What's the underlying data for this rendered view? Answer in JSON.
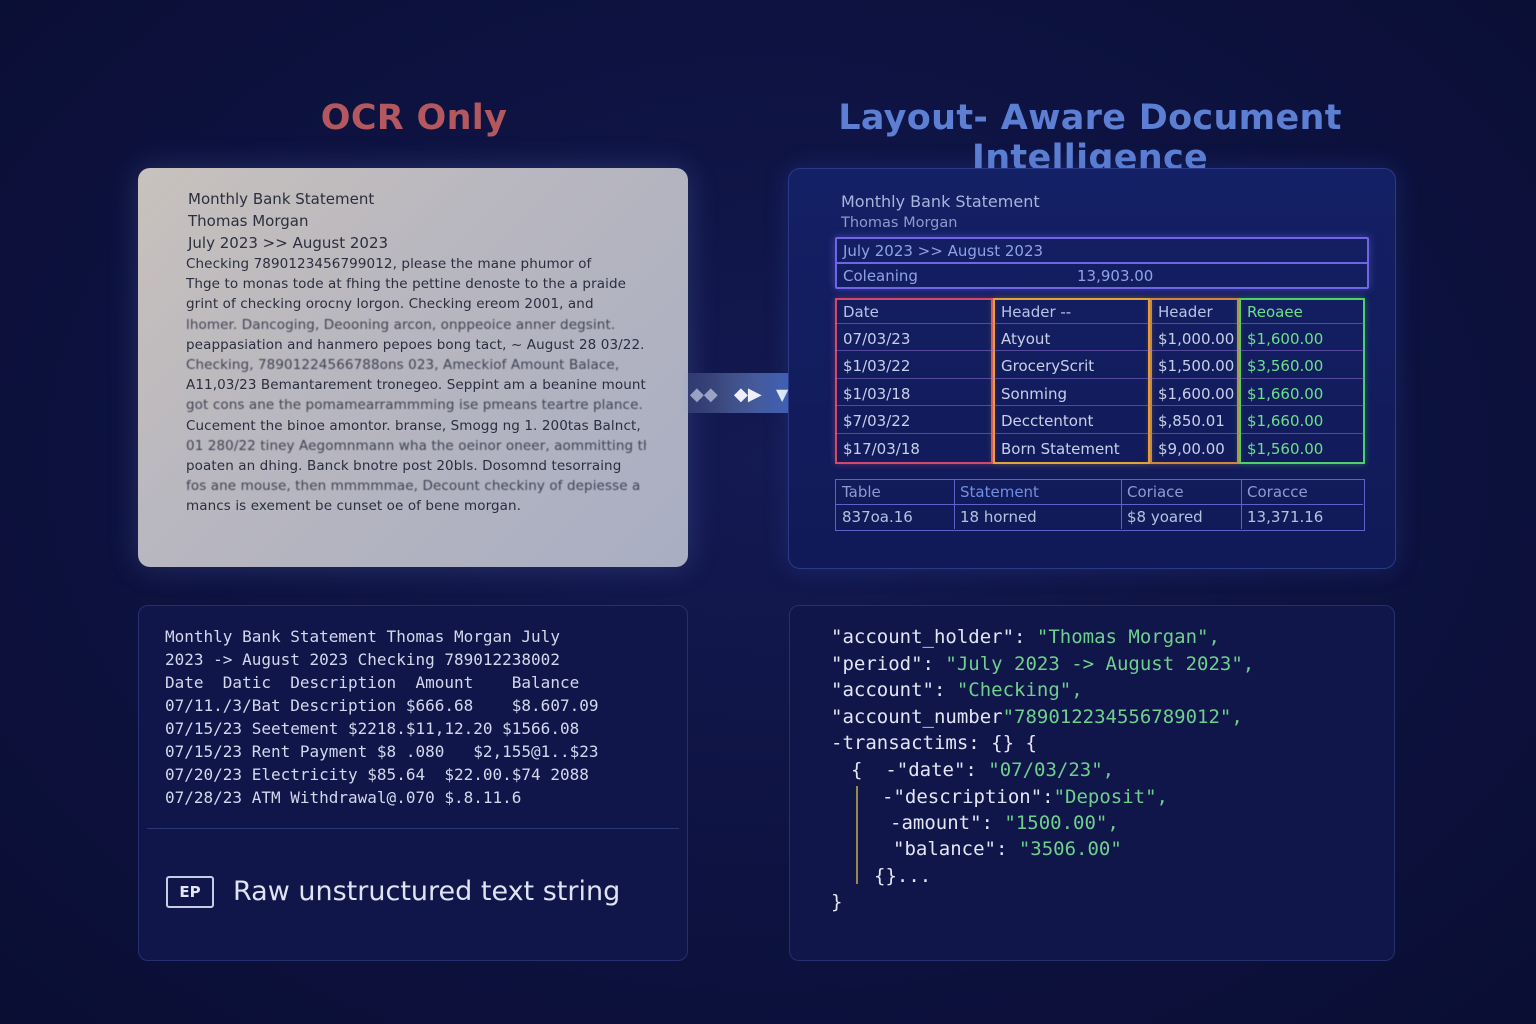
{
  "headings": {
    "left": "OCR Only",
    "right": "Layout- Aware Document Intelligence"
  },
  "scan": {
    "title": "Monthly Bank Statement",
    "name": "Thomas Morgan",
    "period": "July 2023 >> August 2023",
    "lines": [
      "Checking 7890123456799012, please the mane phumor of",
      "Thge to monas tode at fhing the pettine denoste to the a praide",
      "grint of checking orocny lorgon.  Checking ereom 2001, and",
      "lhomer. Dancoging, Deooning arcon, onppeoice anner degsint.",
      "peappasiation and hanmero pepoes bong tact, ~ August 28 03/22.",
      "Checking, 78901224566788ons 023, Ameckiof Amount Balace,",
      "A11,03/23 Bemantarement tronegeo. Seppint am a beanine mount.",
      "got cons ane the pomamearrammming ise pmeans teartre plance.",
      "Cucement the binoe amontor. branse, Smogg ng 1. 200tas Balnct,",
      "01 280/22 tiney Aegomnmann wha the oeinor oneer, aommitting the",
      "poaten an dhing. Banck bnotre post 20bls. Dosomnd tesorraing",
      "fos ane mouse, then mmmmmae, Decount checkiny of depiesse a",
      "mancs is exement be cunset oe of bene morgan."
    ]
  },
  "structured": {
    "title": "Monthly Bank Statement",
    "name": "Thomas Morgan",
    "period": "July 2023 >> August 2023",
    "account_label": "Coleaning",
    "account_value": "13,903.00",
    "columns": [
      {
        "header": "Date",
        "color": "#d24a6b",
        "cells": [
          "07/03/23",
          "$1/03/22",
          "$1/03/18",
          "$7/03/22",
          "$17/03/18"
        ]
      },
      {
        "header": "Header --",
        "color": "#e0a43a",
        "cells": [
          "Atyout",
          "GroceryScrit",
          "Sonming",
          "Decctentont",
          "Born Statement"
        ]
      },
      {
        "header": "Header",
        "color": "#d0863f",
        "cells": [
          "$1,000.00",
          "$1,500.00",
          "$1,600.00",
          "$,850.01",
          "$9,00.00"
        ]
      },
      {
        "header": "Reoaee",
        "color": "#4fcf6a",
        "cells": [
          "$1,600.00",
          "$3,560.00",
          "$1,660.00",
          "$1,660.00",
          "$1,560.00"
        ]
      }
    ],
    "summary": {
      "headers": [
        "Table",
        "Statement",
        "Coriace",
        "Coracce"
      ],
      "values": [
        "837oa.16",
        "18 horned",
        "$8 yoared",
        "13,371.16"
      ]
    }
  },
  "raw_text": {
    "lines": [
      "Monthly Bank Statement Thomas Morgan July",
      "2023 -> August 2023 Checking 789012238002",
      "Date  Datic  Description  Amount    Balance",
      "07/11./3/Bat Description $666.68    $8.607.09",
      "07/15/23 Seetement $2218.$11,12.20 $1566.08",
      "07/15/23 Rent Payment $8 .080   $2,155@1..$23",
      "07/20/23 Electricity $85.64  $22.00.$74 2088",
      "07/28/23 ATM Withdrawal@.070 $.8.11.6"
    ],
    "badge": "EP",
    "caption": "Raw unstructured text string"
  },
  "json_view": {
    "account_holder_key": "\"account_holder\": ",
    "account_holder_val": "\"Thomas Morgan\",",
    "period_key": "\"period\": ",
    "period_val": "\"July 2023 -> August 2023\",",
    "account_key": "\"account\": ",
    "account_val": "\"Checking\",",
    "account_number_key": "\"account_number",
    "account_number_val": "\"789012234556789012\",",
    "transactions": "-transactims: {} {",
    "open": "{  -\"date\": ",
    "date_val": "\"07/03/23\",",
    "description_key": "-\"description\":",
    "description_val": "\"Deposit\",",
    "amount_key": "-amount\": ",
    "amount_val": "\"1500.00\",",
    "balance_key": "\"balance\": ",
    "balance_val": "\"3506.00\"",
    "ellipsis": "{}...",
    "close": "}"
  }
}
